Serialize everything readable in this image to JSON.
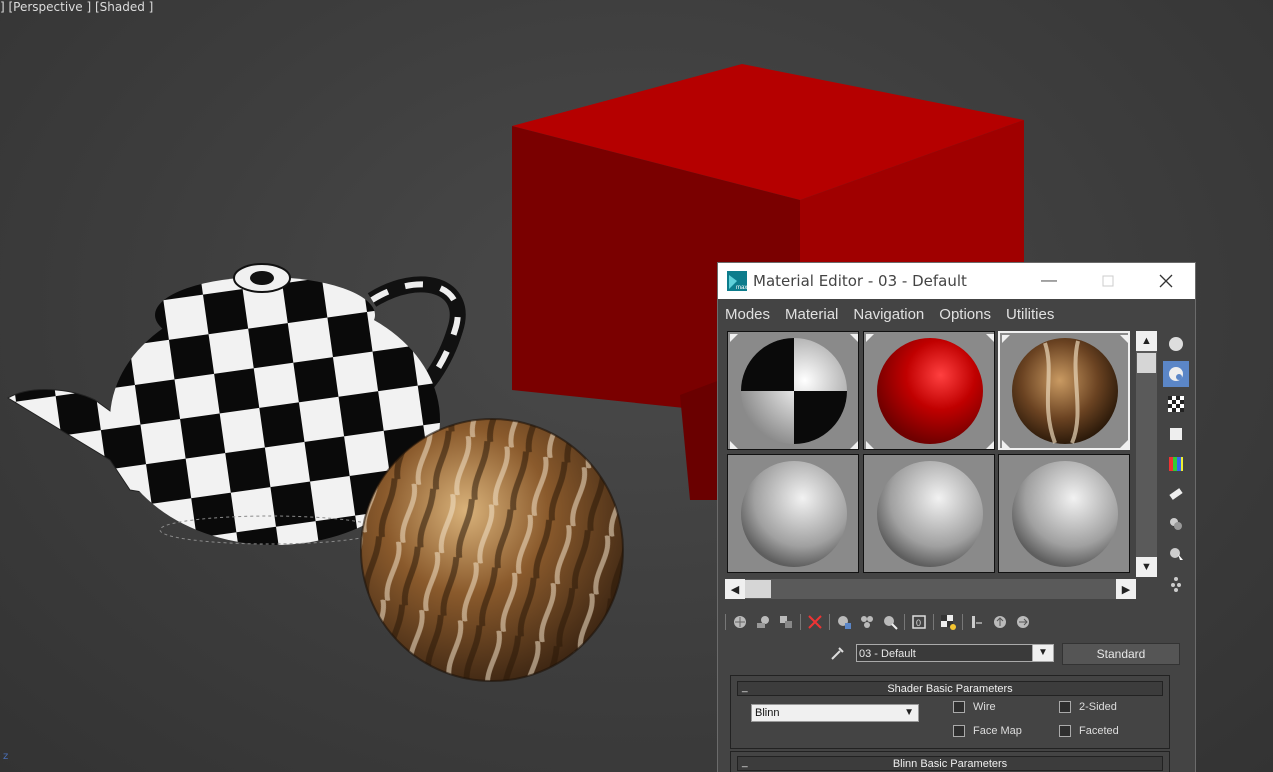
{
  "viewport": {
    "label": "] [Perspective ] [Shaded ]",
    "axis_label": "z"
  },
  "editor": {
    "title": "Material Editor - 03 - Default",
    "app_icon": "3ds-max-icon",
    "menu": [
      "Modes",
      "Material",
      "Navigation",
      "Options",
      "Utilities"
    ],
    "slots": [
      {
        "name": "checker-material",
        "active": false
      },
      {
        "name": "red-material",
        "active": false
      },
      {
        "name": "wood-material",
        "active": true
      },
      {
        "name": "default-material-4",
        "active": false
      },
      {
        "name": "default-material-5",
        "active": false
      },
      {
        "name": "default-material-6",
        "active": false
      }
    ],
    "material_name": "03 - Default",
    "material_type": "Standard",
    "shader_rollout": {
      "title": "Shader Basic Parameters",
      "collapse": "_",
      "shader": "Blinn",
      "wire": "Wire",
      "two_sided": "2-Sided",
      "face_map": "Face Map",
      "faceted": "Faceted"
    },
    "blinn_rollout": {
      "title": "Blinn Basic Parameters",
      "collapse": "_"
    }
  }
}
